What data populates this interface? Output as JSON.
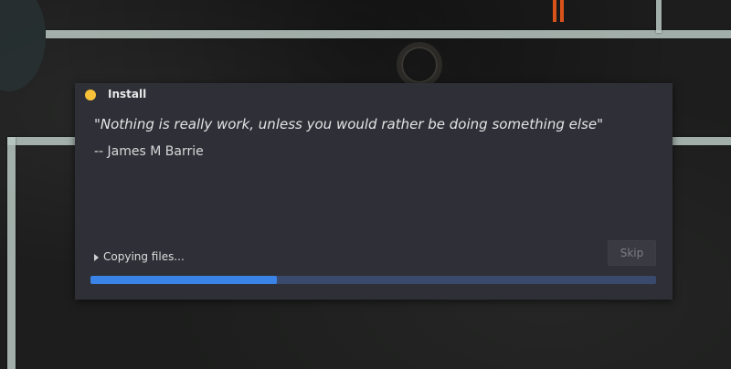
{
  "dialog": {
    "title": "Install",
    "title_dot_color": "#f7c23a",
    "quote": "\"Nothing is really work, unless you would rather be doing something else\"",
    "author": "-- James M Barrie",
    "status": "Copying files...",
    "skip_label": "Skip",
    "progress": 0.33,
    "progress_color": "#3a84e8"
  }
}
